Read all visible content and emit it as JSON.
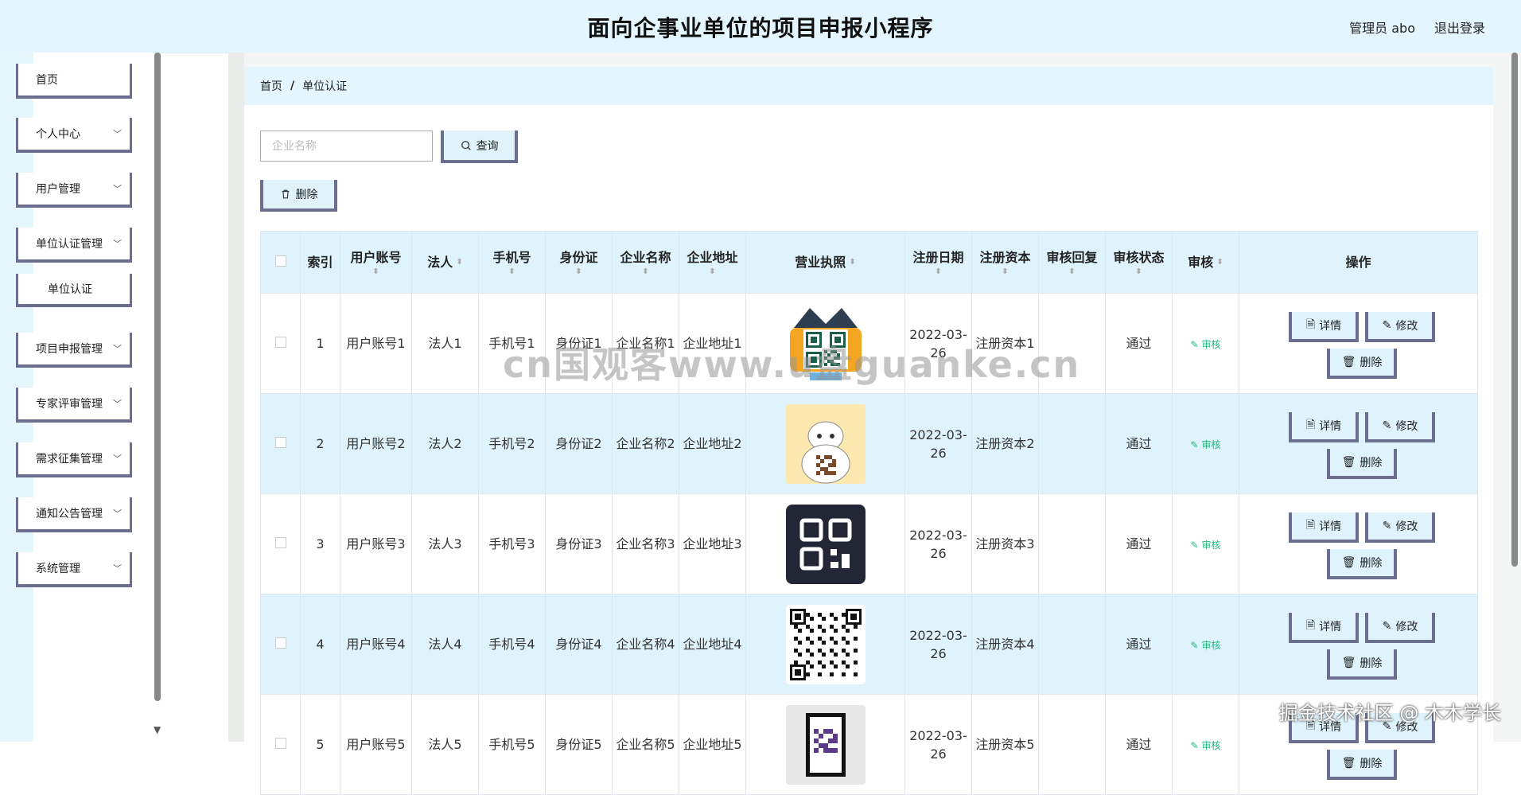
{
  "header": {
    "title": "面向企事业单位的项目申报小程序",
    "user": "管理员 abo",
    "logout": "退出登录"
  },
  "sidebar": {
    "items": [
      {
        "label": "首页",
        "chevron": false
      },
      {
        "label": "个人中心",
        "chevron": true
      },
      {
        "label": "用户管理",
        "chevron": true
      },
      {
        "label": "单位认证管理",
        "chevron": true
      },
      {
        "label": "单位认证",
        "chevron": false,
        "sub": true
      },
      {
        "label": "项目申报管理",
        "chevron": true
      },
      {
        "label": "专家评审管理",
        "chevron": true
      },
      {
        "label": "需求征集管理",
        "chevron": true
      },
      {
        "label": "通知公告管理",
        "chevron": true
      },
      {
        "label": "系统管理",
        "chevron": true
      }
    ]
  },
  "breadcrumb": {
    "home": "首页",
    "separator": "/",
    "current": "单位认证"
  },
  "toolbar": {
    "search_placeholder": "企业名称",
    "search_value": "",
    "query_label": "查询",
    "delete_label": "删除"
  },
  "table": {
    "headers": {
      "index": "索引",
      "account": "用户账号",
      "legal": "法人",
      "phone": "手机号",
      "idcard": "身份证",
      "company": "企业名称",
      "address": "企业地址",
      "license": "营业执照",
      "regdate": "注册日期",
      "capital": "注册资本",
      "reply": "审核回复",
      "status": "审核状态",
      "review": "审核",
      "actions": "操作"
    },
    "rows": [
      {
        "index": "1",
        "account": "用户账号1",
        "legal": "法人1",
        "phone": "手机号1",
        "idcard": "身份证1",
        "company": "企业名称1",
        "address": "企业地址1",
        "regdate": "2022-03-26",
        "capital": "注册资本1",
        "reply": "",
        "status": "通过",
        "review": "审核",
        "license_icon": "qr-robot-icon"
      },
      {
        "index": "2",
        "account": "用户账号2",
        "legal": "法人2",
        "phone": "手机号2",
        "idcard": "身份证2",
        "company": "企业名称2",
        "address": "企业地址2",
        "regdate": "2022-03-26",
        "capital": "注册资本2",
        "reply": "",
        "status": "通过",
        "review": "审核",
        "license_icon": "qr-cartoon-icon"
      },
      {
        "index": "3",
        "account": "用户账号3",
        "legal": "法人3",
        "phone": "手机号3",
        "idcard": "身份证3",
        "company": "企业名称3",
        "address": "企业地址3",
        "regdate": "2022-03-26",
        "capital": "注册资本3",
        "reply": "",
        "status": "通过",
        "review": "审核",
        "license_icon": "qr-dark-icon"
      },
      {
        "index": "4",
        "account": "用户账号4",
        "legal": "法人4",
        "phone": "手机号4",
        "idcard": "身份证4",
        "company": "企业名称4",
        "address": "企业地址4",
        "regdate": "2022-03-26",
        "capital": "注册资本4",
        "reply": "",
        "status": "通过",
        "review": "审核",
        "license_icon": "qr-code-icon"
      },
      {
        "index": "5",
        "account": "用户账号5",
        "legal": "法人5",
        "phone": "手机号5",
        "idcard": "身份证5",
        "company": "企业名称5",
        "address": "企业地址5",
        "regdate": "2022-03-26",
        "capital": "注册资本5",
        "reply": "",
        "status": "通过",
        "review": "审核",
        "license_icon": "qr-frame-icon"
      }
    ],
    "action_labels": {
      "detail": "详情",
      "edit": "修改",
      "delete": "删除"
    }
  },
  "watermark": "cn国观客www.u盘guanke.cn",
  "corner_mark": "掘金技术社区 @ 木木学长",
  "colors": {
    "accent": "#6b6e8f",
    "light_blue": "#def3fc",
    "approve_green": "#1fb97c"
  }
}
